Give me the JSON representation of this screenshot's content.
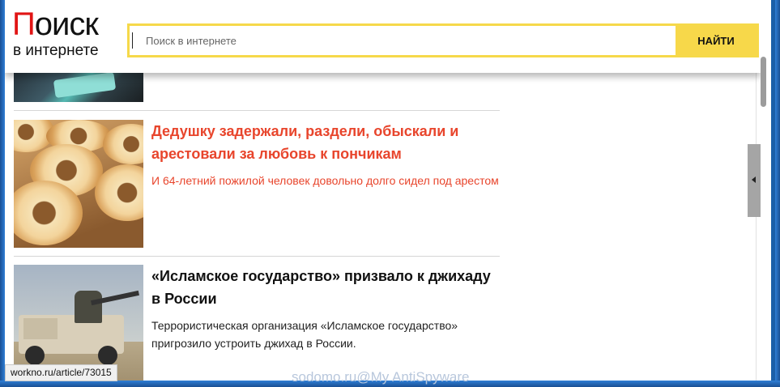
{
  "header": {
    "logo_line1_first": "П",
    "logo_line1_rest": "оиск",
    "logo_line2": "в интернете",
    "search_placeholder": "Поиск в интернете",
    "search_button": "НАЙТИ"
  },
  "articles": [
    {
      "title": "Дедушку задержали, раздели, обыскали и арестовали за любовь к пончикам",
      "description": "И 64-летний пожилой человек довольно долго сидел под арестом"
    },
    {
      "title": "«Исламское государство» призвало к джихаду в России",
      "description": "Террористическая организация «Исламское государство» пригрозило устроить джихад в России."
    }
  ],
  "status_bar": {
    "url": "workno.ru/article/73015"
  },
  "watermark": "sodomo.ru@My AntiSpyware",
  "colors": {
    "accent_yellow": "#f7d84a",
    "logo_red": "#e11414",
    "link_red": "#e8452c"
  }
}
